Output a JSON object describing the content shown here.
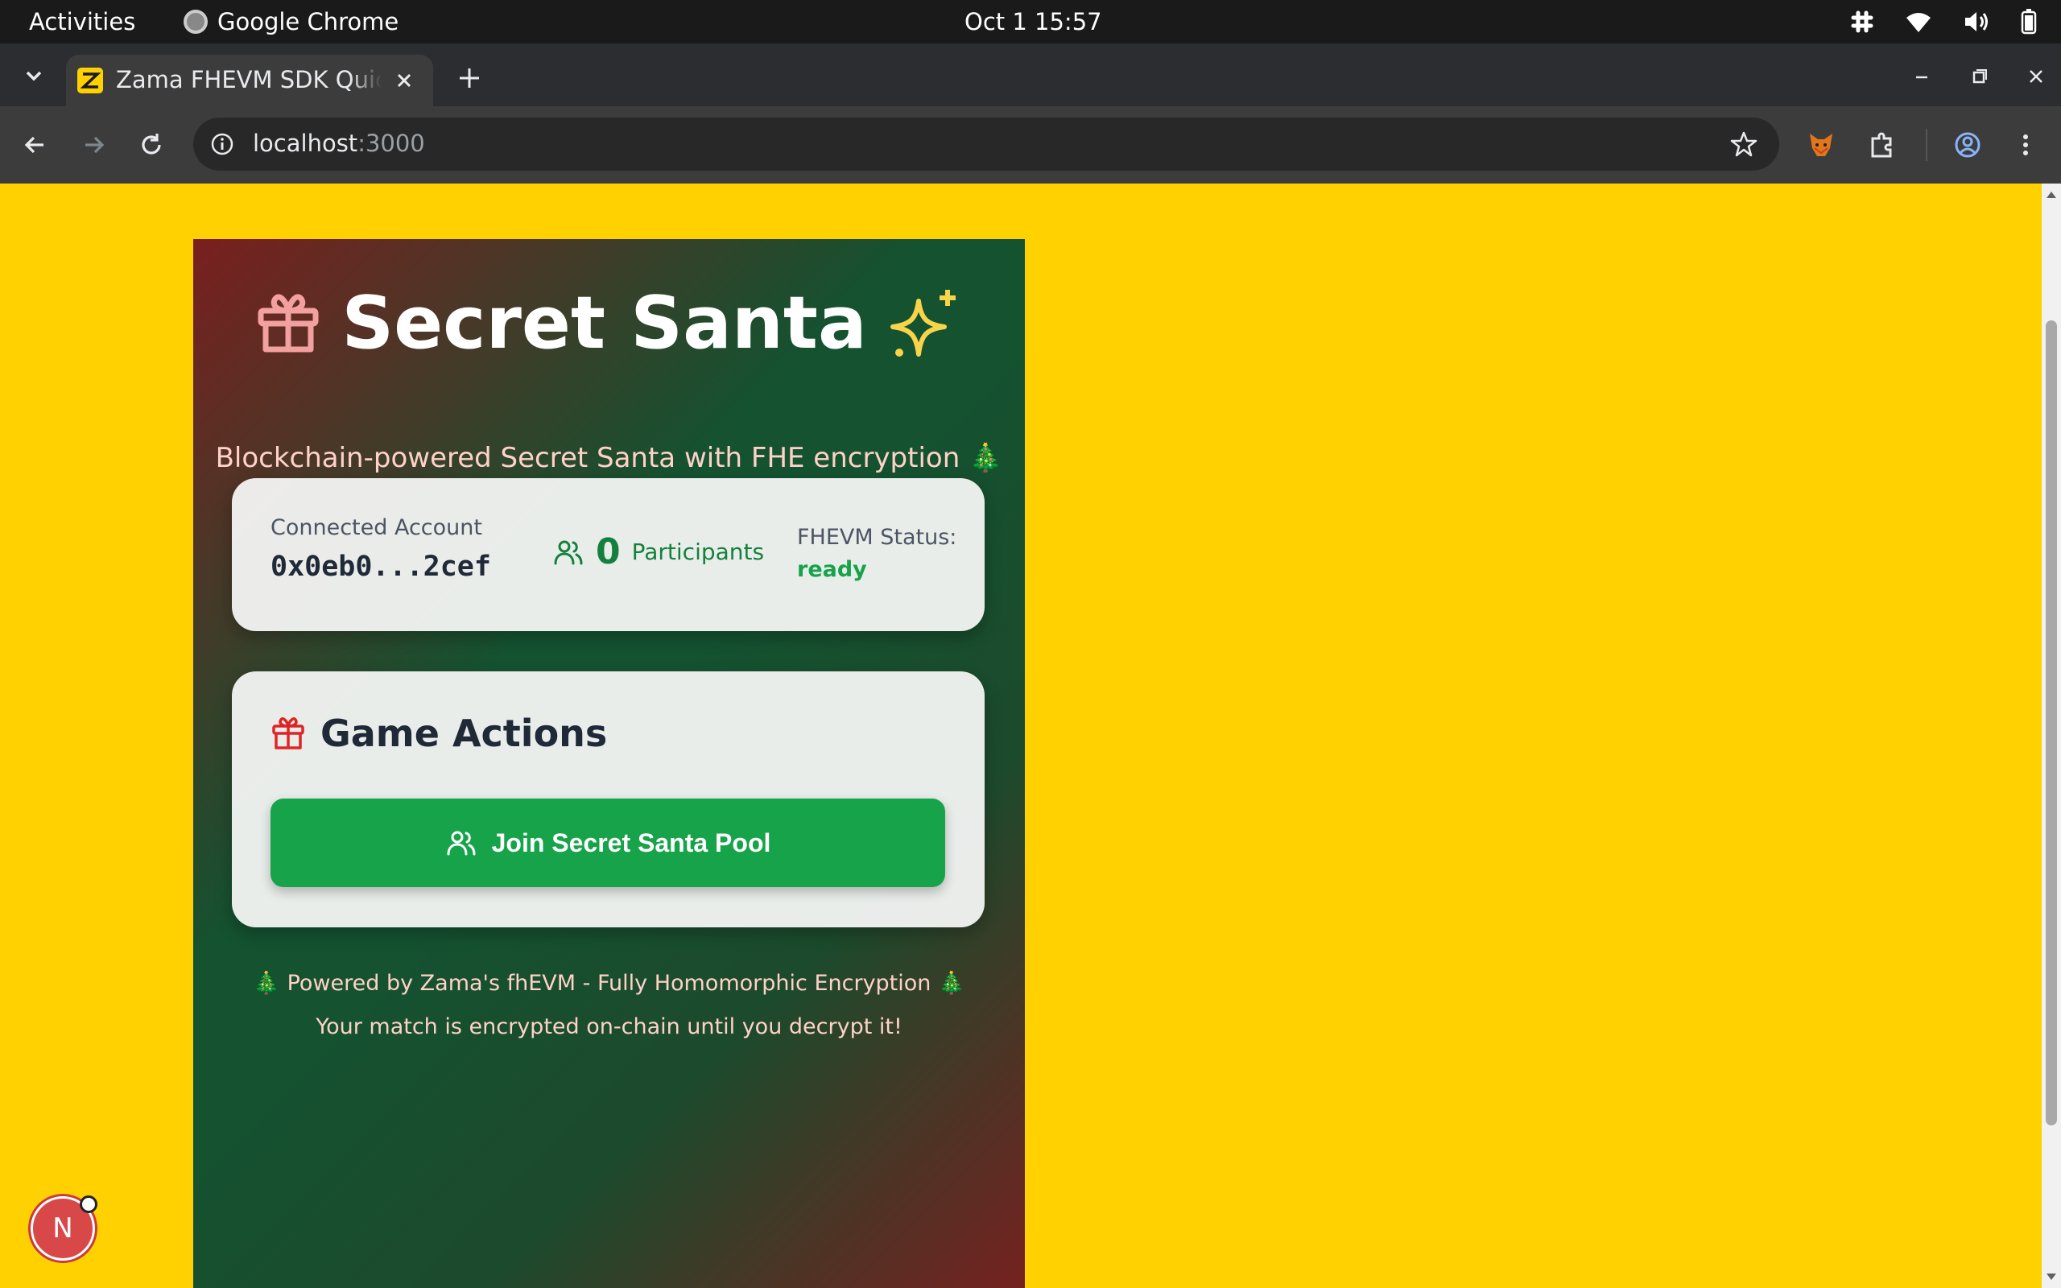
{
  "os_bar": {
    "activities": "Activities",
    "app_name": "Google Chrome",
    "clock": "Oct 1  15:57"
  },
  "browser": {
    "tab_title": "Zama FHEVM SDK Quickstart",
    "url_host": "localhost",
    "url_port": ":3000"
  },
  "page": {
    "title": "Secret Santa",
    "subtitle": "Blockchain-powered Secret Santa with FHE encryption 🎄",
    "account": {
      "label": "Connected Account",
      "address": "0x0eb0...2cef"
    },
    "participants": {
      "count": "0",
      "label": "Participants"
    },
    "status": {
      "label": "FHEVM Status:",
      "value": "ready"
    },
    "actions": {
      "heading": "Game Actions",
      "join_button": "Join Secret Santa Pool"
    },
    "footer": {
      "line1": "🎄 Powered by Zama's fhEVM - Fully Homomorphic Encryption 🎄",
      "line2": "Your match is encrypted on-chain until you decrypt it!"
    },
    "dev_badge": "N"
  },
  "colors": {
    "page_bg": "#ffd100",
    "accent_green": "#16a34a",
    "gift_pink": "#f2a0a0",
    "sparkle_yellow": "#f7d44a"
  }
}
